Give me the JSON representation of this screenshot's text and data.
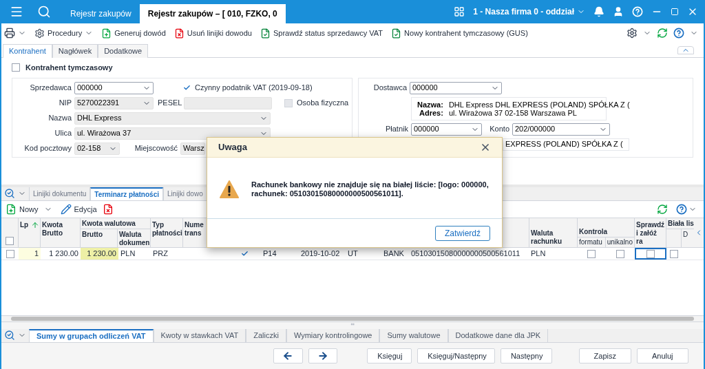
{
  "top_bar": {
    "tabs": [
      {
        "label": "Rejestr zakupów",
        "selected": false
      },
      {
        "label": "Rejestr zakupów – [ 010, FZKO, 0",
        "selected": true
      }
    ],
    "company": "1 - Nasza firma 0 - oddział"
  },
  "toolbar": {
    "buttons": [
      {
        "kind": "procedures",
        "label": "Procedury",
        "dropdown": true
      },
      {
        "kind": "generate",
        "label": "Generuj dowód",
        "dropdown": false
      },
      {
        "kind": "delete",
        "label": "Usuń linijki dowodu",
        "dropdown": false
      },
      {
        "kind": "check",
        "label": "Sprawdź status sprzedawcy VAT",
        "dropdown": false
      },
      {
        "kind": "check",
        "label": "Nowy kontrahent tymczasowy (GUS)",
        "dropdown": false
      }
    ]
  },
  "form_tabs": [
    {
      "label": "Kontrahent",
      "selected": true
    },
    {
      "label": "Nagłówek",
      "selected": false
    },
    {
      "label": "Dodatkowe",
      "selected": false
    }
  ],
  "temporary_contractor": {
    "label": "Kontrahent tymczasowy",
    "checked": false
  },
  "seller_box": {
    "seller": {
      "label": "Sprzedawca",
      "value": "000000"
    },
    "vat_payer": {
      "label": "Czynny podatnik VAT (2019-09-18)",
      "checked": true
    },
    "nip": {
      "label": "NIP",
      "value": "5270022391"
    },
    "pesel": {
      "label": "PESEL"
    },
    "natural_person": {
      "label": "Osoba fizyczna",
      "checked": false
    },
    "name": {
      "label": "Nazwa",
      "value": "DHL Express"
    },
    "street": {
      "label": "Ulica",
      "value": "ul. Wirażowa 37"
    },
    "postal_code": {
      "label": "Kod pocztowy",
      "value": "02-158"
    },
    "city": {
      "label": "Miejscowość",
      "value": "Warsz"
    }
  },
  "delivery_box": {
    "supplier": {
      "label": "Dostawca",
      "value": "000000"
    },
    "name_label": "Nazwa:",
    "name": "DHL Express DHL EXPRESS (POLAND) SPÓŁKA Z (",
    "address_label": "Adres:",
    "address": "ul. Wirażowa 37 02-158 Warszawa PL",
    "payer": {
      "label": "Płatnik",
      "value": "000000"
    },
    "account": {
      "label": "Konto",
      "value": "202/000000"
    },
    "payer_name": "EXPRESS (POLAND) SPÓŁKA Z ("
  },
  "lower_tabs": [
    {
      "label": "Linijki dokumentu",
      "selected": false
    },
    {
      "label": "Terminarz płatności",
      "selected": true
    },
    {
      "label": "Linijki dowo",
      "selected": false
    }
  ],
  "grid_toolbar": {
    "new": "Nowy",
    "edit": "Edycja"
  },
  "table": {
    "header": {
      "select_all_checked": false,
      "lp": "Lp",
      "gross_amount": "Kwota Brutto",
      "currency_amount": "Kwota walutowa",
      "currency_gross": "Brutto",
      "document_currency": "Waluta dokumen",
      "payment_type": "Typ płatności",
      "column_7": "Nume trans",
      "account_currency": "Waluta rachunku",
      "control": "Kontrola",
      "format": "formatu",
      "uniqueness": "unikalno",
      "check_create": "Sprawdź i załóż ra",
      "white_list": "Biała lis",
      "white_list_sub": "D"
    },
    "rows": [
      {
        "selected": false,
        "lp": "1",
        "gross": "1 230.00",
        "currency_gross": "1 230.00",
        "currency": "PLN",
        "payment_type": "PRZ",
        "checked": true,
        "code": "P14",
        "date": "2019-10-02",
        "column_ut": "UT",
        "column_bank": "BANK",
        "account_number": "05103015080000000500561011",
        "account_currency": "PLN",
        "format_check": false,
        "uniqueness_check": false,
        "check_create": false,
        "white_list": false
      }
    ]
  },
  "bottom_tabs": [
    {
      "label": "Sumy w grupach odliczeń VAT",
      "selected": true
    },
    {
      "label": "Kwoty w stawkach VAT",
      "selected": false
    },
    {
      "label": "Zaliczki",
      "selected": false
    },
    {
      "label": "Wymiary kontrolingowe",
      "selected": false
    },
    {
      "label": "Sumy walutowe",
      "selected": false
    },
    {
      "label": "Dodatkowe dane dla JPK",
      "selected": false
    }
  ],
  "actions": {
    "left": [
      "Księguj",
      "Księguj/Następny",
      "Następny"
    ],
    "right": [
      "Zapisz",
      "Anuluj"
    ]
  },
  "dialog": {
    "title": "Uwaga",
    "message": "Rachunek bankowy nie znajduje się na białej liście: [logo: 000000, rachunek: 05103015080000000500561011].",
    "button": "Zatwierdź"
  }
}
